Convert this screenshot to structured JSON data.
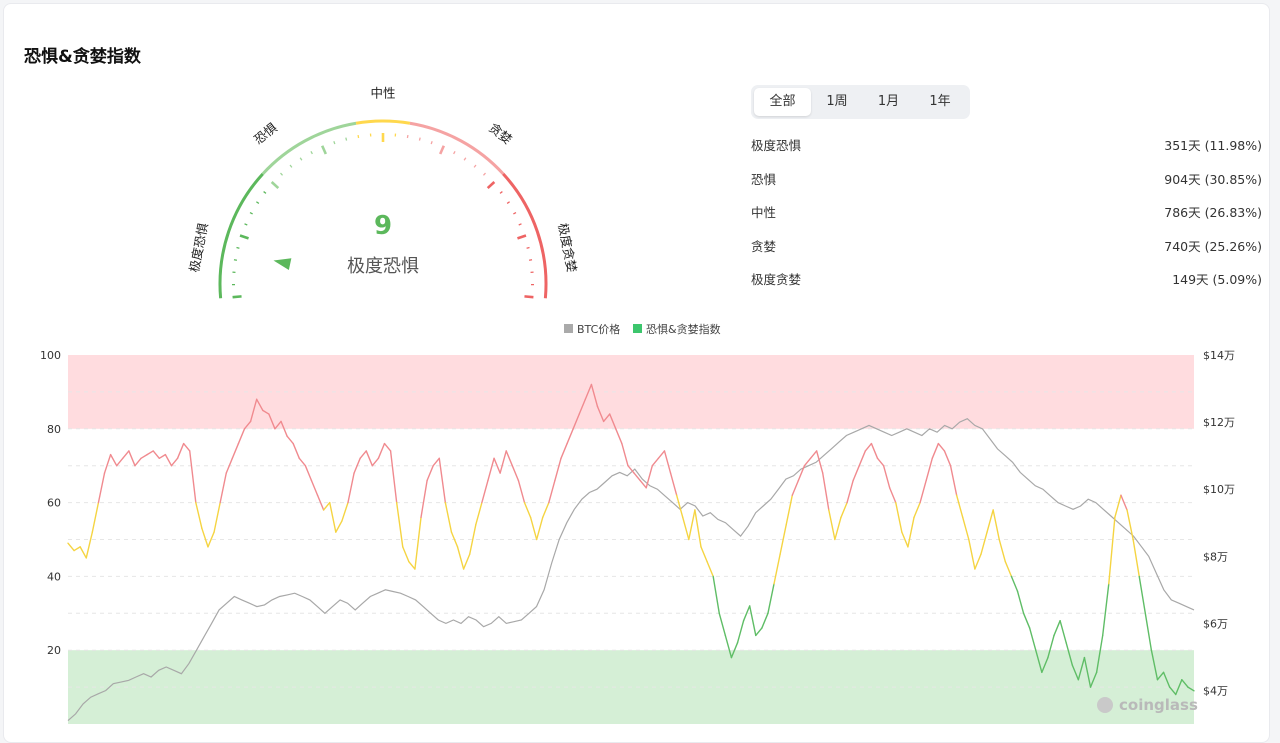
{
  "page_title": "恐惧&贪婪指数",
  "gauge": {
    "value": "9",
    "value_num": 9,
    "label": "极度恐惧",
    "segments": [
      "极度恐惧",
      "恐惧",
      "中性",
      "贪婪",
      "极度贪婪"
    ],
    "colors": {
      "green": "#5cb85c",
      "light_green": "#9fd59a",
      "yellow": "#ffd84d",
      "light_red": "#f5a3a3",
      "red": "#ee6464"
    }
  },
  "tabs": [
    {
      "label": "全部",
      "active": true
    },
    {
      "label": "1周",
      "active": false
    },
    {
      "label": "1月",
      "active": false
    },
    {
      "label": "1年",
      "active": false
    }
  ],
  "stats": [
    {
      "label": "极度恐惧",
      "value": "351天 (11.98%)"
    },
    {
      "label": "恐惧",
      "value": "904天 (30.85%)"
    },
    {
      "label": "中性",
      "value": "786天 (26.83%)"
    },
    {
      "label": "贪婪",
      "value": "740天 (25.26%)"
    },
    {
      "label": "极度贪婪",
      "value": "149天 (5.09%)"
    }
  ],
  "chart_data": {
    "type": "line",
    "legend": [
      "BTC价格",
      "恐惧&贪婪指数"
    ],
    "legend_colors": [
      "#aaaaaa",
      "#3cc66d"
    ],
    "y_left": {
      "ticks": [
        "100",
        "80",
        "60",
        "40",
        "20"
      ],
      "range": [
        0,
        100
      ]
    },
    "y_right": {
      "ticks": [
        "$14万",
        "$12万",
        "$10万",
        "$8万",
        "$6万",
        "$4万"
      ],
      "range": [
        30000,
        140000
      ]
    },
    "bands": [
      {
        "from": 80,
        "to": 100,
        "color": "#ffdcdf"
      },
      {
        "from": 0,
        "to": 20,
        "color": "#d5efd6"
      }
    ],
    "thresholds": {
      "extreme_greed": 80,
      "greed": 60,
      "neutral": 40,
      "fear": 20
    },
    "series": [
      {
        "name": "恐惧&贪婪指数",
        "axis": "left",
        "values": [
          49,
          47,
          48,
          45,
          52,
          60,
          68,
          73,
          70,
          72,
          74,
          70,
          72,
          73,
          74,
          72,
          73,
          70,
          72,
          76,
          74,
          60,
          53,
          48,
          52,
          60,
          68,
          72,
          76,
          80,
          82,
          88,
          85,
          84,
          80,
          82,
          78,
          76,
          72,
          70,
          66,
          62,
          58,
          60,
          52,
          55,
          60,
          68,
          72,
          74,
          70,
          72,
          76,
          74,
          60,
          48,
          44,
          42,
          56,
          66,
          70,
          72,
          60,
          52,
          48,
          42,
          46,
          54,
          60,
          66,
          72,
          68,
          74,
          70,
          66,
          60,
          56,
          50,
          56,
          60,
          66,
          72,
          76,
          80,
          84,
          88,
          92,
          86,
          82,
          84,
          80,
          76,
          70,
          68,
          66,
          64,
          70,
          72,
          74,
          68,
          62,
          56,
          50,
          58,
          48,
          44,
          40,
          30,
          24,
          18,
          22,
          28,
          32,
          24,
          26,
          30,
          38,
          46,
          54,
          62,
          66,
          70,
          72,
          74,
          68,
          58,
          50,
          56,
          60,
          66,
          70,
          74,
          76,
          72,
          70,
          64,
          60,
          52,
          48,
          56,
          60,
          66,
          72,
          76,
          74,
          70,
          62,
          56,
          50,
          42,
          46,
          52,
          58,
          50,
          44,
          40,
          36,
          30,
          26,
          20,
          14,
          18,
          24,
          28,
          22,
          16,
          12,
          18,
          10,
          14,
          24,
          38,
          56,
          62,
          58,
          50,
          40,
          30,
          20,
          12,
          14,
          10,
          8,
          12,
          10,
          9
        ]
      },
      {
        "name": "BTC价格",
        "axis": "right",
        "values": [
          31000,
          33000,
          36000,
          38000,
          39000,
          40000,
          42000,
          42500,
          43000,
          44000,
          45000,
          44000,
          46000,
          47000,
          46000,
          45000,
          48000,
          52000,
          56000,
          60000,
          64000,
          66000,
          68000,
          67000,
          66000,
          65000,
          65500,
          67000,
          68000,
          68500,
          69000,
          68000,
          67000,
          65000,
          63000,
          65000,
          67000,
          66000,
          64000,
          66000,
          68000,
          69000,
          70000,
          69500,
          69000,
          68000,
          67000,
          65000,
          63000,
          61000,
          60000,
          61000,
          60000,
          62000,
          61000,
          59000,
          60000,
          62000,
          60000,
          60500,
          61000,
          63000,
          65000,
          70000,
          78000,
          85000,
          90000,
          94000,
          97000,
          99000,
          100000,
          102000,
          104000,
          105000,
          104000,
          106000,
          103000,
          101000,
          100000,
          98000,
          96000,
          94000,
          96000,
          95000,
          92000,
          93000,
          91000,
          90000,
          88000,
          86000,
          89000,
          93000,
          95000,
          97000,
          100000,
          103000,
          104000,
          106000,
          107000,
          108000,
          110000,
          112000,
          114000,
          116000,
          117000,
          118000,
          119000,
          118000,
          117000,
          116000,
          117000,
          118000,
          117000,
          116000,
          118000,
          117000,
          119000,
          118000,
          120000,
          121000,
          119000,
          118000,
          115000,
          112000,
          110000,
          108000,
          105000,
          103000,
          101000,
          100000,
          98000,
          96000,
          95000,
          94000,
          95000,
          97000,
          96000,
          94000,
          92000,
          90000,
          88000,
          86000,
          83000,
          80000,
          75000,
          70000,
          67000,
          66000,
          65000,
          64000
        ]
      }
    ],
    "watermark": "coinglass"
  }
}
